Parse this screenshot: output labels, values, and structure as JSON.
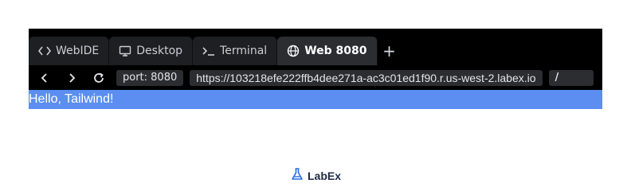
{
  "tabs": [
    {
      "label": "WebIDE",
      "icon": "code-brackets-icon"
    },
    {
      "label": "Desktop",
      "icon": "monitor-icon"
    },
    {
      "label": "Terminal",
      "icon": "terminal-icon"
    },
    {
      "label": "Web 8080",
      "icon": "globe-icon",
      "active": true
    }
  ],
  "add_tab": "+",
  "toolbar": {
    "port": "port: 8080",
    "url": "https://103218efe222ffb4dee271a-ac3c01ed1f90.r.us-west-2.labex.io",
    "path": "/"
  },
  "page": {
    "body_text": "Hello, Tailwind!"
  },
  "brand": {
    "name": "LabEx"
  },
  "colors": {
    "tabbar_bg": "#000000",
    "content_bar": "#5B8EF0",
    "brand": "#2B6BE3"
  }
}
